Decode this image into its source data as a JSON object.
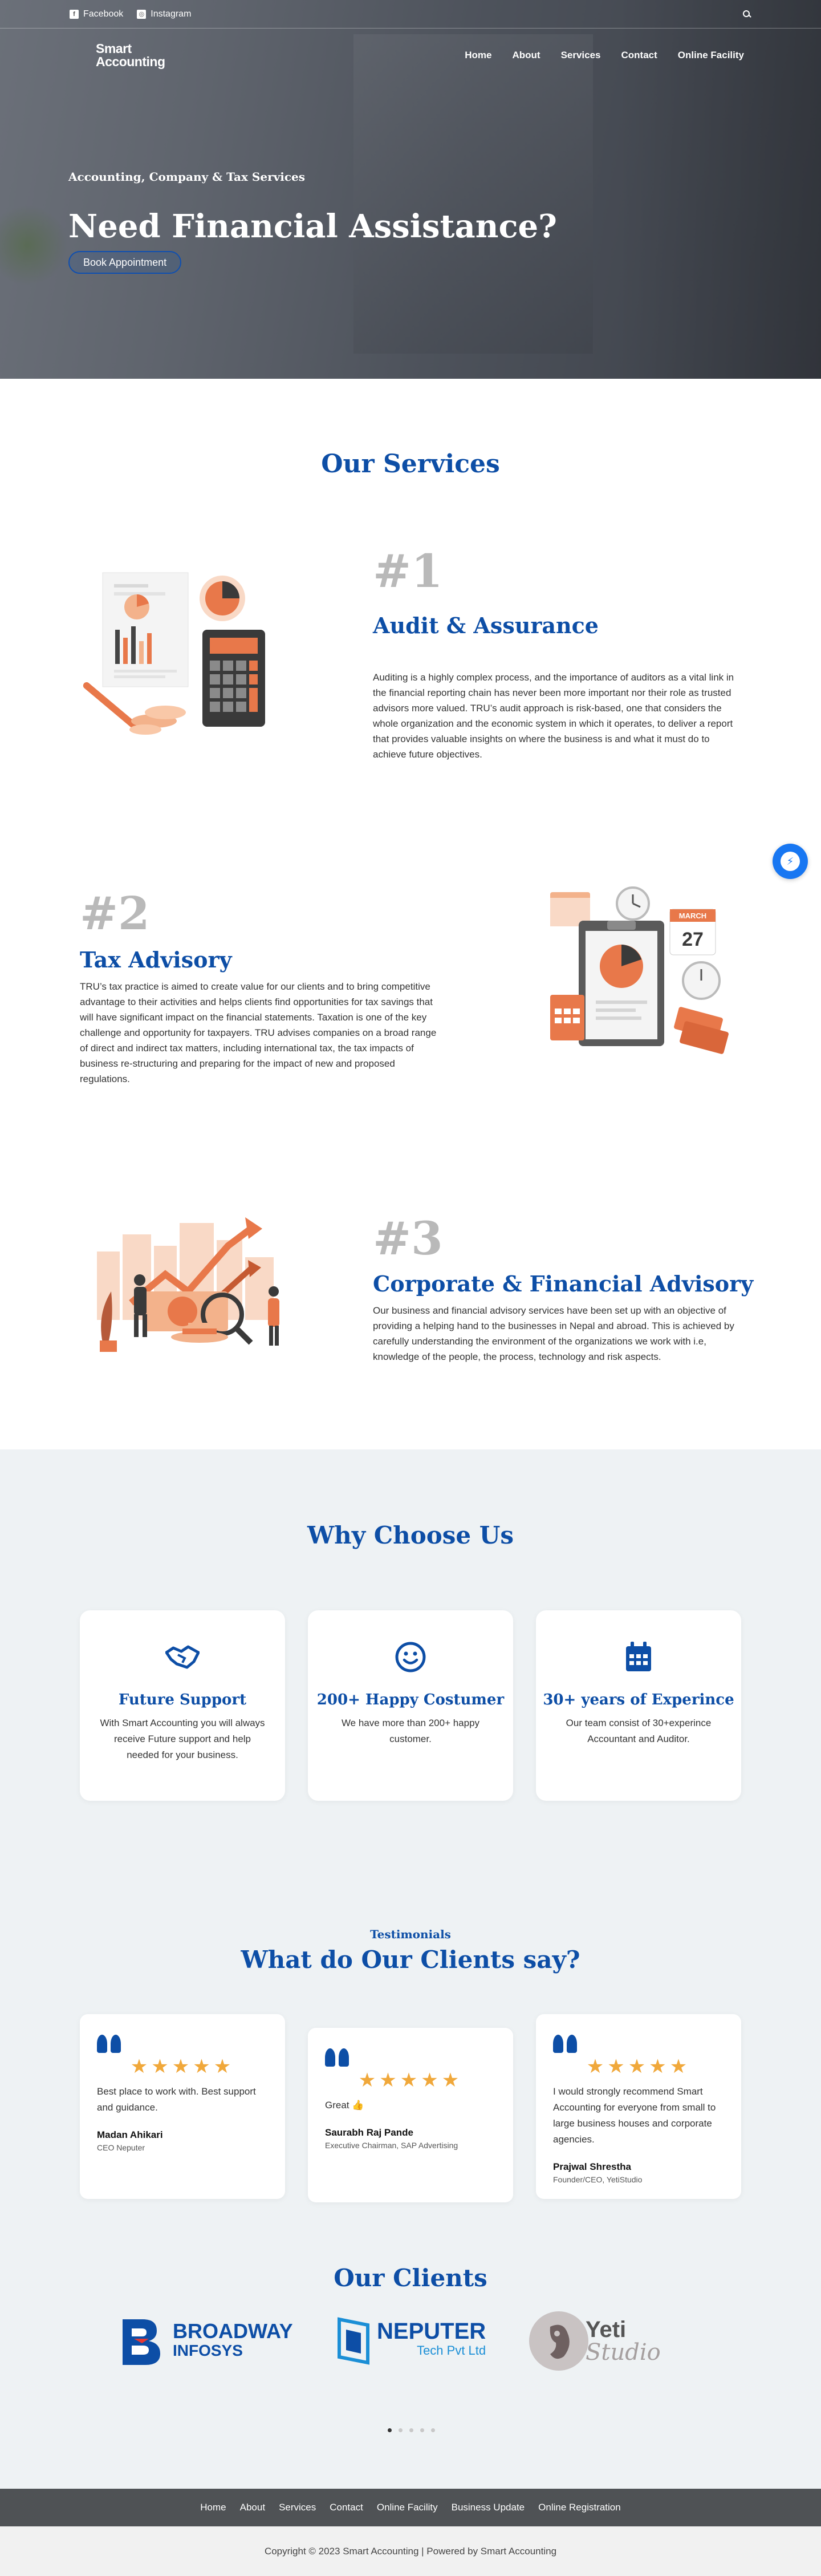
{
  "topbar": {
    "facebook_label": "Facebook",
    "instagram_label": "Instagram",
    "facebook_icon": "facebook-icon",
    "instagram_icon": "instagram-icon",
    "search_icon": "search-icon"
  },
  "nav": {
    "logo_line1": "Smart",
    "logo_line2": "Accounting",
    "items": [
      {
        "label": "Home"
      },
      {
        "label": "About"
      },
      {
        "label": "Services"
      },
      {
        "label": "Contact"
      },
      {
        "label": "Online Facility"
      }
    ]
  },
  "hero": {
    "subtitle": "Accounting, Company & Tax Services",
    "title": "Need Financial Assistance?",
    "button_label": "Book Appointment"
  },
  "services": {
    "title": "Our Services",
    "items": [
      {
        "number": "#1",
        "title": "Audit & Assurance",
        "text": "Auditing is a highly complex process, and the importance of auditors as a vital link in the financial reporting chain has never been more important nor their role as trusted advisors more valued. TRU’s audit approach is risk-based, one that considers the whole organization and the economic system in which it operates, to deliver a report that provides valuable insights on where the business is and what it must do to achieve future objectives."
      },
      {
        "number": "#2",
        "title": "Tax Advisory",
        "text": "TRU’s tax practice is aimed to create value for our clients and to bring competitive advantage to their activities and helps clients find opportunities for tax savings that will have significant impact on the financial statements. Taxation is one of the key challenge and opportunity for taxpayers. TRU advises companies on a broad range of direct and indirect tax matters, including international tax, the tax impacts of business re-structuring and preparing for the impact of new and proposed regulations."
      },
      {
        "number": "#3",
        "title": "Corporate & Financial Advisory",
        "text": "Our business and financial advisory services have been set up with an objective of providing a helping hand to the businesses in Nepal and abroad. This is achieved by carefully understanding the environment of the organizations we work with i.e, knowledge of the people, the process, technology and risk aspects."
      }
    ],
    "calendar_month": "MARCH",
    "calendar_day": "27"
  },
  "why": {
    "title": "Why Choose Us",
    "cards": [
      {
        "icon": "handshake-icon",
        "title": "Future Support",
        "text": "With Smart Accounting you will always receive Future support and help needed for your business."
      },
      {
        "icon": "smile-icon",
        "title": "200+ Happy Costumer",
        "text": "We have more than 200+ happy customer."
      },
      {
        "icon": "calendar-icon",
        "title": "30+ years of Experince",
        "text": "Our team consist of 30+experince Accountant and Auditor."
      }
    ]
  },
  "testimonials": {
    "eyebrow": "Testimonials",
    "title": "What do Our Clients say?",
    "rating_stars": 5,
    "items": [
      {
        "quote": "Best place to work with. Best support and guidance.",
        "name": "Madan Ahikari",
        "role": "CEO Neputer"
      },
      {
        "quote": "Great 👍",
        "name": "Saurabh Raj Pande",
        "role": "Executive Chairman, SAP Advertising"
      },
      {
        "quote": "I would strongly recommend Smart Accounting for everyone from small to large business houses and corporate agencies.",
        "name": "Prajwal Shrestha",
        "role": "Founder/CEO, YetiStudio"
      }
    ]
  },
  "clients": {
    "title": "Our Clients",
    "logos": [
      {
        "line1": "BROADWAY",
        "line2": "INFOSYS"
      },
      {
        "line1": "NEPUTER",
        "line2": "Tech Pvt Ltd"
      },
      {
        "line1": "Yeti",
        "line2": "Studio"
      }
    ]
  },
  "footer": {
    "links": [
      {
        "label": "Home"
      },
      {
        "label": "About"
      },
      {
        "label": "Services"
      },
      {
        "label": "Contact"
      },
      {
        "label": "Online Facility"
      },
      {
        "label": "Business Update"
      },
      {
        "label": "Online Registration"
      }
    ],
    "copyright": "Copyright © 2023 Smart Accounting | Powered by Smart Accounting"
  },
  "colors": {
    "brand_blue": "#0d4ea6",
    "accent_orange": "#e8784a",
    "star_gold": "#f0a83b",
    "messenger_blue": "#1877f2"
  }
}
